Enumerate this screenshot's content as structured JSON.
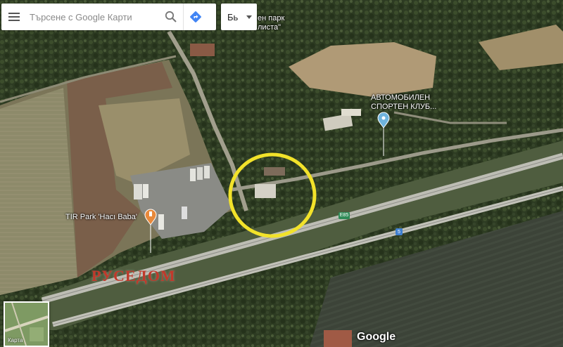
{
  "search": {
    "placeholder": "Търсене с Google Карти"
  },
  "language": {
    "selected": "Бь"
  },
  "labels": {
    "park_line1": "ен парк",
    "park_line2": "листа\"",
    "club_line1": "АВТОМОБИЛЕН",
    "club_line2": "СПОРТЕН КЛУБ...",
    "tir_park": "TIR Park 'Hacı Baba'"
  },
  "road_labels": {
    "e85": "E85",
    "route": "5"
  },
  "watermark": "РУСЕДОМ",
  "footer": {
    "google": "Google",
    "minimap_label": "Карта"
  },
  "colors": {
    "highlight_circle": "#f2e22a",
    "place_pin_blue": "#6fb4dd",
    "place_pin_orange": "#e8893b",
    "watermark": "#c0392b"
  },
  "icons": {
    "menu": "hamburger-menu-icon",
    "search": "search-icon",
    "directions": "directions-icon",
    "pin_club": "map-pin-icon",
    "pin_tir": "map-pin-icon"
  }
}
